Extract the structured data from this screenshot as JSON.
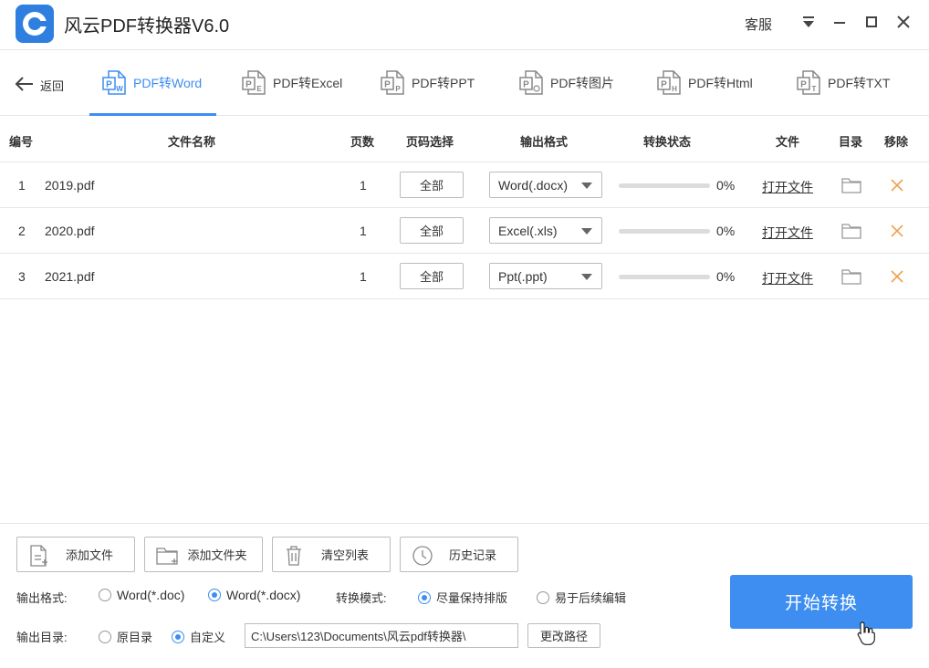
{
  "app": {
    "title": "风云PDF转换器V6.0",
    "service_label": "客服"
  },
  "nav": {
    "back_label": "返回",
    "tabs": [
      {
        "label": "PDF转Word",
        "icon": "pdf-to-word-icon",
        "active": true
      },
      {
        "label": "PDF转Excel",
        "icon": "pdf-to-excel-icon",
        "active": false
      },
      {
        "label": "PDF转PPT",
        "icon": "pdf-to-ppt-icon",
        "active": false
      },
      {
        "label": "PDF转图片",
        "icon": "pdf-to-image-icon",
        "active": false
      },
      {
        "label": "PDF转Html",
        "icon": "pdf-to-html-icon",
        "active": false
      },
      {
        "label": "PDF转TXT",
        "icon": "pdf-to-txt-icon",
        "active": false
      }
    ]
  },
  "table": {
    "headers": {
      "index": "编号",
      "filename": "文件名称",
      "pages": "页数",
      "page_select": "页码选择",
      "output_format": "输出格式",
      "status": "转换状态",
      "file": "文件",
      "dir": "目录",
      "remove": "移除"
    },
    "rows": [
      {
        "index": "1",
        "filename": "2019.pdf",
        "pages": "1",
        "page_select": "全部",
        "format": "Word(.docx)",
        "progress": 0,
        "progress_text": "0%",
        "open_label": "打开文件"
      },
      {
        "index": "2",
        "filename": "2020.pdf",
        "pages": "1",
        "page_select": "全部",
        "format": "Excel(.xls)",
        "progress": 0,
        "progress_text": "0%",
        "open_label": "打开文件"
      },
      {
        "index": "3",
        "filename": "2021.pdf",
        "pages": "1",
        "page_select": "全部",
        "format": "Ppt(.ppt)",
        "progress": 0,
        "progress_text": "0%",
        "open_label": "打开文件"
      }
    ]
  },
  "actions": {
    "add_file": "添加文件",
    "add_folder": "添加文件夹",
    "clear_list": "清空列表",
    "history": "历史记录"
  },
  "options": {
    "output_format_label": "输出格式:",
    "format_doc": "Word(*.doc)",
    "format_docx": "Word(*.docx)",
    "format_selected": "docx",
    "mode_label": "转换模式:",
    "mode_keep_layout": "尽量保持排版",
    "mode_editable": "易于后续编辑",
    "mode_selected": "keep_layout",
    "output_dir_label": "输出目录:",
    "dir_original": "原目录",
    "dir_custom": "自定义",
    "dir_selected": "custom",
    "path_value": "C:\\Users\\123\\Documents\\风云pdf转换器\\",
    "change_path": "更改路径"
  },
  "start_button": "开始转换",
  "colors": {
    "accent": "#3d8ef0",
    "remove_x": "#f0a050"
  }
}
